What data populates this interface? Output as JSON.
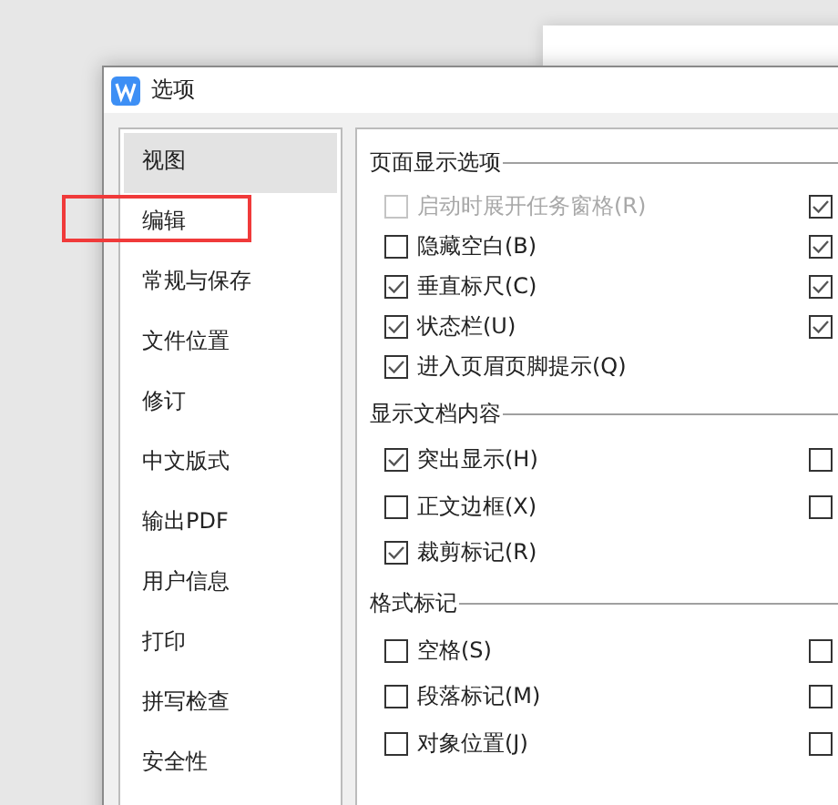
{
  "window": {
    "title": "选项"
  },
  "sidebar": {
    "items": [
      {
        "label": "视图",
        "selected": true,
        "annotated": false
      },
      {
        "label": "编辑",
        "selected": false,
        "annotated": true
      },
      {
        "label": "常规与保存",
        "selected": false,
        "annotated": false
      },
      {
        "label": "文件位置",
        "selected": false,
        "annotated": false
      },
      {
        "label": "修订",
        "selected": false,
        "annotated": false
      },
      {
        "label": "中文版式",
        "selected": false,
        "annotated": false
      },
      {
        "label": "输出PDF",
        "selected": false,
        "annotated": false
      },
      {
        "label": "用户信息",
        "selected": false,
        "annotated": false
      },
      {
        "label": "打印",
        "selected": false,
        "annotated": false
      },
      {
        "label": "拼写检查",
        "selected": false,
        "annotated": false
      },
      {
        "label": "安全性",
        "selected": false,
        "annotated": false
      }
    ]
  },
  "sections": [
    {
      "title": "页面显示选项",
      "left": [
        {
          "label": "启动时展开任务窗格(R)",
          "checked": false,
          "disabled": true
        },
        {
          "label": "隐藏空白(B)",
          "checked": false,
          "disabled": false
        },
        {
          "label": "垂直标尺(C)",
          "checked": true,
          "disabled": false
        },
        {
          "label": "状态栏(U)",
          "checked": true,
          "disabled": false
        },
        {
          "label": "进入页眉页脚提示(Q)",
          "checked": true,
          "disabled": false
        }
      ],
      "right": [
        {
          "checked": true
        },
        {
          "checked": true
        },
        {
          "checked": true
        },
        {
          "checked": true
        }
      ]
    },
    {
      "title": "显示文档内容",
      "left": [
        {
          "label": "突出显示(H)",
          "checked": true,
          "disabled": false
        },
        {
          "label": "正文边框(X)",
          "checked": false,
          "disabled": false
        },
        {
          "label": "裁剪标记(R)",
          "checked": true,
          "disabled": false
        }
      ],
      "right": [
        {
          "checked": false
        },
        {
          "checked": false
        }
      ]
    },
    {
      "title": "格式标记",
      "left": [
        {
          "label": "空格(S)",
          "checked": false,
          "disabled": false
        },
        {
          "label": "段落标记(M)",
          "checked": false,
          "disabled": false
        },
        {
          "label": "对象位置(J)",
          "checked": false,
          "disabled": false
        }
      ],
      "right": [
        {
          "checked": false
        },
        {
          "checked": false
        },
        {
          "checked": false
        }
      ]
    }
  ]
}
